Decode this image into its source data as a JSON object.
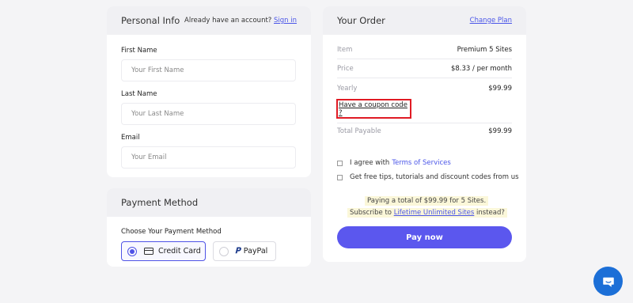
{
  "personal_info": {
    "title": "Personal Info",
    "already_text": "Already have an account?",
    "sign_in": "Sign in",
    "fields": [
      {
        "label": "First Name",
        "placeholder": "Your First Name"
      },
      {
        "label": "Last Name",
        "placeholder": "Your Last Name"
      },
      {
        "label": "Email",
        "placeholder": "Your Email"
      }
    ]
  },
  "payment_method": {
    "title": "Payment Method",
    "choose_label": "Choose Your Payment Method",
    "options": [
      {
        "label": "Credit Card",
        "icon": "credit-card-icon",
        "selected": true
      },
      {
        "label": "PayPal",
        "icon": "paypal-icon",
        "selected": false
      }
    ]
  },
  "order": {
    "title": "Your Order",
    "change_plan": "Change Plan",
    "rows": [
      {
        "key": "Item",
        "value": "Premium 5 Sites"
      },
      {
        "key": "Price",
        "value": "$8.33 / per month"
      },
      {
        "key": "Yearly",
        "value": "$99.99"
      }
    ],
    "coupon_link": "Have a coupon code ?",
    "total_label": "Total Payable",
    "total_value": "$99.99",
    "agree_prefix": "I agree with",
    "agree_link": "Terms of Services",
    "tips_label": "Get free tips, tutorials and discount codes from us",
    "paying_note": "Paying a total of $99.99 for 5 Sites.",
    "subscribe_prefix": "Subscribe to",
    "subscribe_link": "Lifetime Unlimited Sites",
    "subscribe_suffix": "instead?",
    "pay_button": "Pay now"
  },
  "colors": {
    "accent": "#5b57ee",
    "link": "#4a55e8",
    "highlight_box": "#e01b24",
    "chat_bubble": "#1c6fd7"
  },
  "chat": {
    "icon": "chat-bubble-icon"
  }
}
